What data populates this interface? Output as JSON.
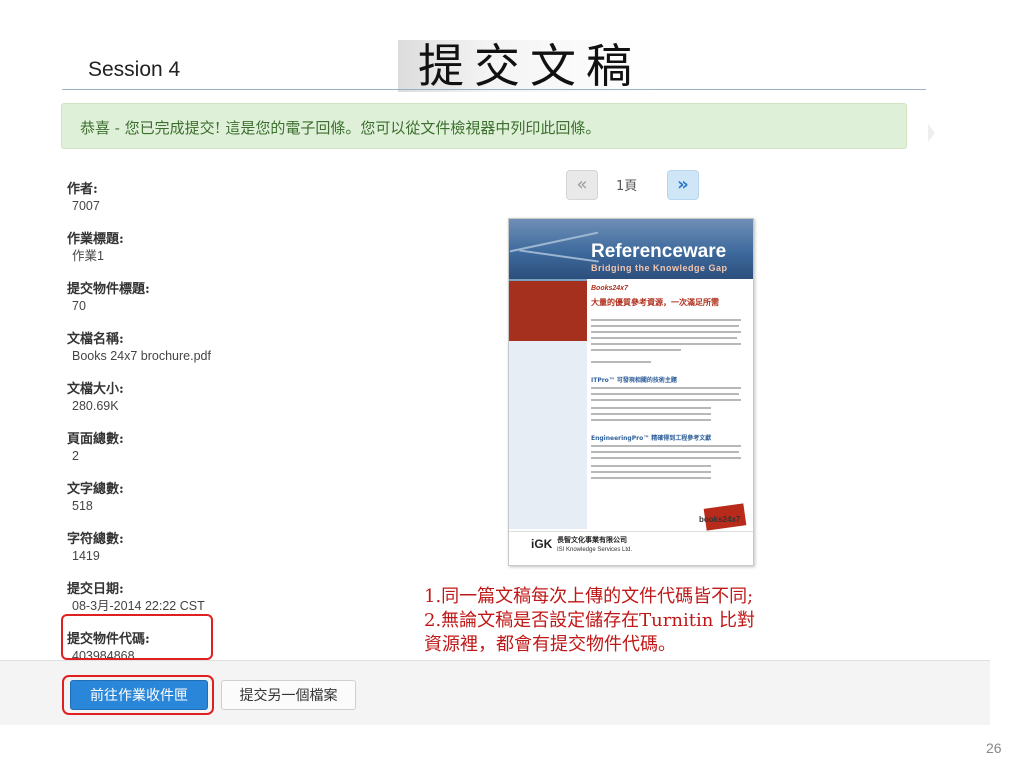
{
  "header": {
    "session": "Session 4",
    "title": "提交文稿"
  },
  "alert": {
    "message": "恭喜 - 您已完成提交! 這是您的電子回條。您可以從文件檢視器中列印此回條。"
  },
  "metadata": [
    {
      "label": "作者:",
      "value": "7007"
    },
    {
      "label": "作業標題:",
      "value": "作業1"
    },
    {
      "label": "提交物件標題:",
      "value": "70"
    },
    {
      "label": "文檔名稱:",
      "value": "Books 24x7 brochure.pdf"
    },
    {
      "label": "文檔大小:",
      "value": "280.69K"
    },
    {
      "label": "頁面總數:",
      "value": "2"
    },
    {
      "label": "文字總數:",
      "value": "518"
    },
    {
      "label": "字符總數:",
      "value": "1419"
    },
    {
      "label": "提交日期:",
      "value": "08-3月-2014 22:22 CST"
    },
    {
      "label": "提交物件代碼:",
      "value": "403984868"
    }
  ],
  "pager": {
    "prev_icon": "«",
    "page_label": "1頁",
    "next_icon": "»"
  },
  "preview": {
    "brand": "Referenceware",
    "tagline": "Bridging the Knowledge Gap",
    "heading1": "Books24x7",
    "heading2": "大量的優質參考資源，一次滿足所需",
    "section1": "ITPro™ 可發現相關的技術主題",
    "section2": "EngineeringPro™ 精確得到工程參考文獻",
    "logo_text": "books24x7",
    "company_zh": "長智文化事業有限公司",
    "company_en": "ISI Knowledge Services Ltd."
  },
  "note": {
    "line1": "1.同一篇文稿每次上傳的文件代碼皆不同;",
    "line2": "2.無論文稿是否設定儲存在Turnitin 比對",
    "line3": "資源裡，都會有提交物件代碼。"
  },
  "buttons": {
    "primary": "前往作業收件匣",
    "secondary": "提交另一個檔案"
  },
  "slide_number": "26",
  "colors": {
    "alert_bg": "#dff0d8",
    "primary_button": "#2a86d9",
    "annotation_red": "#c01818"
  }
}
